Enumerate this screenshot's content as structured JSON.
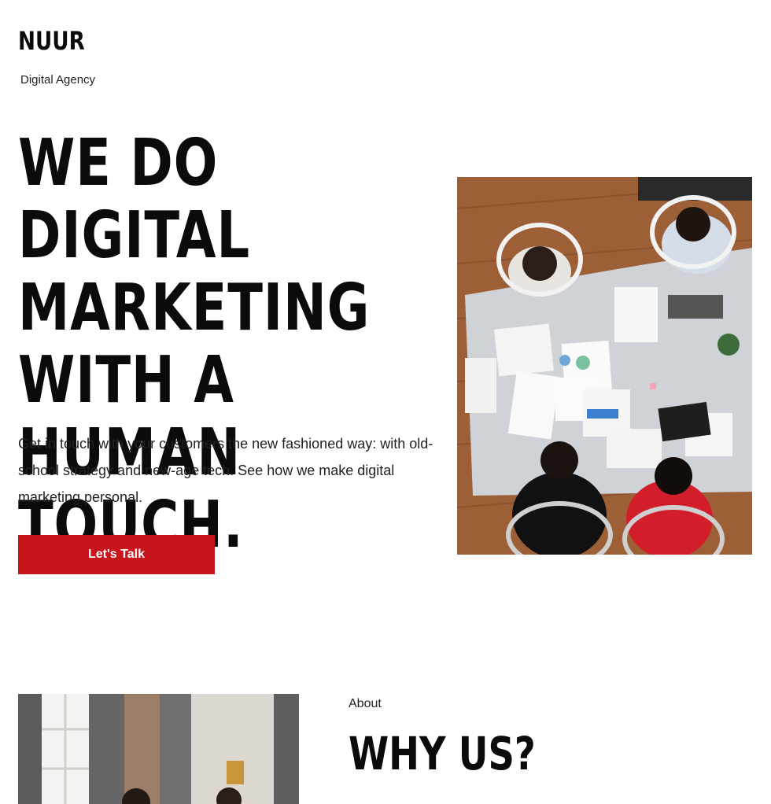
{
  "brand": {
    "name": "NUUR",
    "tagline": "Digital Agency"
  },
  "hero": {
    "title_lines": [
      "WE DO DIGITAL",
      "MARKETING",
      "WITH A HUMAN",
      "TOUCH."
    ],
    "text": "Get in touch with your customers the new fashioned way: with old-school strategy and new-age tech. See how we make digital marketing personal.",
    "cta_label": "Let's Talk",
    "accent_color": "#c8141b"
  },
  "about": {
    "label": "About",
    "title": "WHY US?"
  }
}
